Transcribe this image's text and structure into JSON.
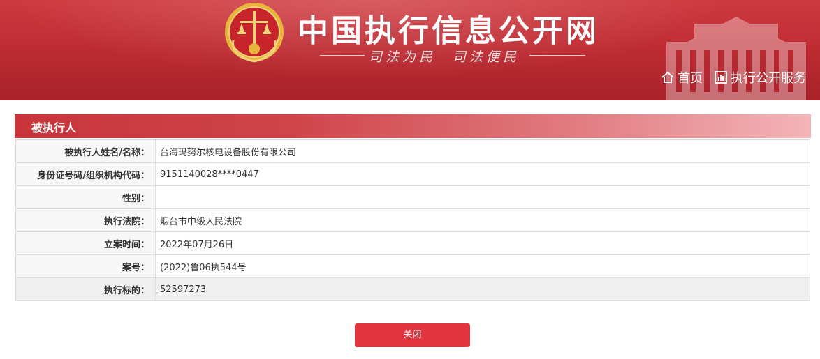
{
  "header": {
    "site_title": "中国执行信息公开网",
    "slogan": "司法为民　司法便民",
    "nav": [
      {
        "icon": "home-icon",
        "label": "首页"
      },
      {
        "icon": "bar-chart-icon",
        "label": "执行公开服务"
      }
    ]
  },
  "section": {
    "title": "被执行人"
  },
  "rows": [
    {
      "label": "被执行人姓名/名称：",
      "value": "台海玛努尔核电设备股份有限公司"
    },
    {
      "label": "身份证号码/组织机构代码：",
      "value": "9151140028****0447"
    },
    {
      "label": "性别：",
      "value": ""
    },
    {
      "label": "执行法院：",
      "value": "烟台市中级人民法院"
    },
    {
      "label": "立案时间：",
      "value": "2022年07月26日"
    },
    {
      "label": "案号：",
      "value": "(2022)鲁06执544号"
    },
    {
      "label": "执行标的：",
      "value": "52597273"
    }
  ],
  "buttons": {
    "close_label": "关闭"
  },
  "colors": {
    "brand_red": "#c9343c",
    "button_red": "#e2353e",
    "emblem_gold": "#e8b53a"
  }
}
